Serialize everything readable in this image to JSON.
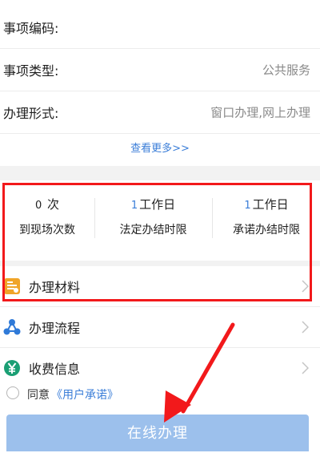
{
  "info_rows": [
    {
      "label": "事项编码:",
      "value": ""
    },
    {
      "label": "事项类型:",
      "value": "公共服务"
    },
    {
      "label": "办理形式:",
      "value": "窗口办理,网上办理"
    }
  ],
  "more_link": "查看更多>>",
  "stats": [
    {
      "number": "0",
      "unit": "次",
      "caption": "到现场次数"
    },
    {
      "number": "1",
      "unit": "工作日",
      "caption": "法定办结时限"
    },
    {
      "number": "1",
      "unit": "工作日",
      "caption": "承诺办结时限"
    }
  ],
  "menu": [
    {
      "label": "办理材料",
      "icon": "document-icon"
    },
    {
      "label": "办理流程",
      "icon": "process-icon"
    },
    {
      "label": "收费信息",
      "icon": "yuan-icon"
    }
  ],
  "agreement": {
    "prefix": "同意",
    "link": "《用户承诺》"
  },
  "submit_label": "在线办理",
  "colors": {
    "accent": "#3b7ed8",
    "button": "#9cc0ec",
    "annotation": "#f2191b",
    "doc_icon": "#f0a428",
    "flow_icon": "#2f7ad8",
    "yuan_icon": "#1a9f74"
  }
}
